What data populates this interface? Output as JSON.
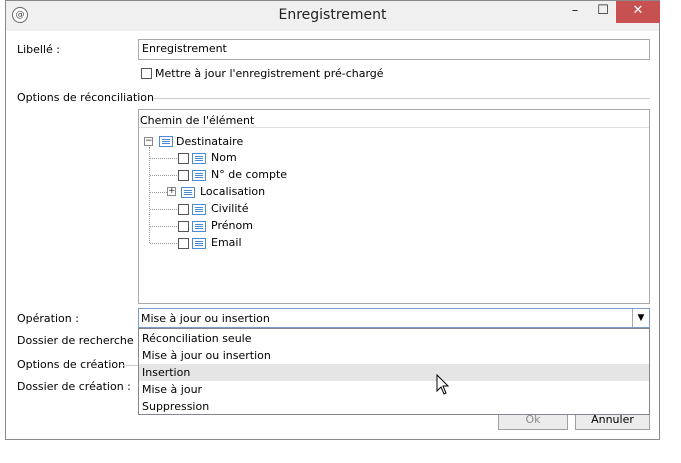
{
  "window": {
    "title": "Enregistrement",
    "app_icon": "app-logo-icon",
    "min": "–",
    "max": "☐",
    "close": "✕"
  },
  "form": {
    "label_field": {
      "label": "Libellé :",
      "value": "Enregistrement"
    },
    "preload_checkbox": {
      "label": "Mettre à jour l'enregistrement pré-chargé",
      "checked": false
    },
    "reconciliation_section": "Options de réconciliation",
    "tree": {
      "header": "Chemin de l'élément",
      "root": "Destinataire",
      "items": [
        "Nom",
        "N° de compte",
        "Localisation",
        "Civilité",
        "Prénom",
        "Email"
      ]
    },
    "operation": {
      "label": "Opération :",
      "selected": "Mise à jour ou insertion",
      "options": [
        "Réconciliation seule",
        "Mise à jour ou insertion",
        "Insertion",
        "Mise à jour",
        "Suppression"
      ],
      "highlighted": "Insertion"
    },
    "search_folder_label": "Dossier de recherche :",
    "creation_options_label": "Options de création",
    "creation_folder_label": "Dossier de création :"
  },
  "buttons": {
    "ok": "Ok",
    "cancel": "Annuler"
  },
  "colors": {
    "close_button": "#c75050",
    "highlight": "#e5e5e5",
    "list_icon": "#4a8ad6"
  }
}
